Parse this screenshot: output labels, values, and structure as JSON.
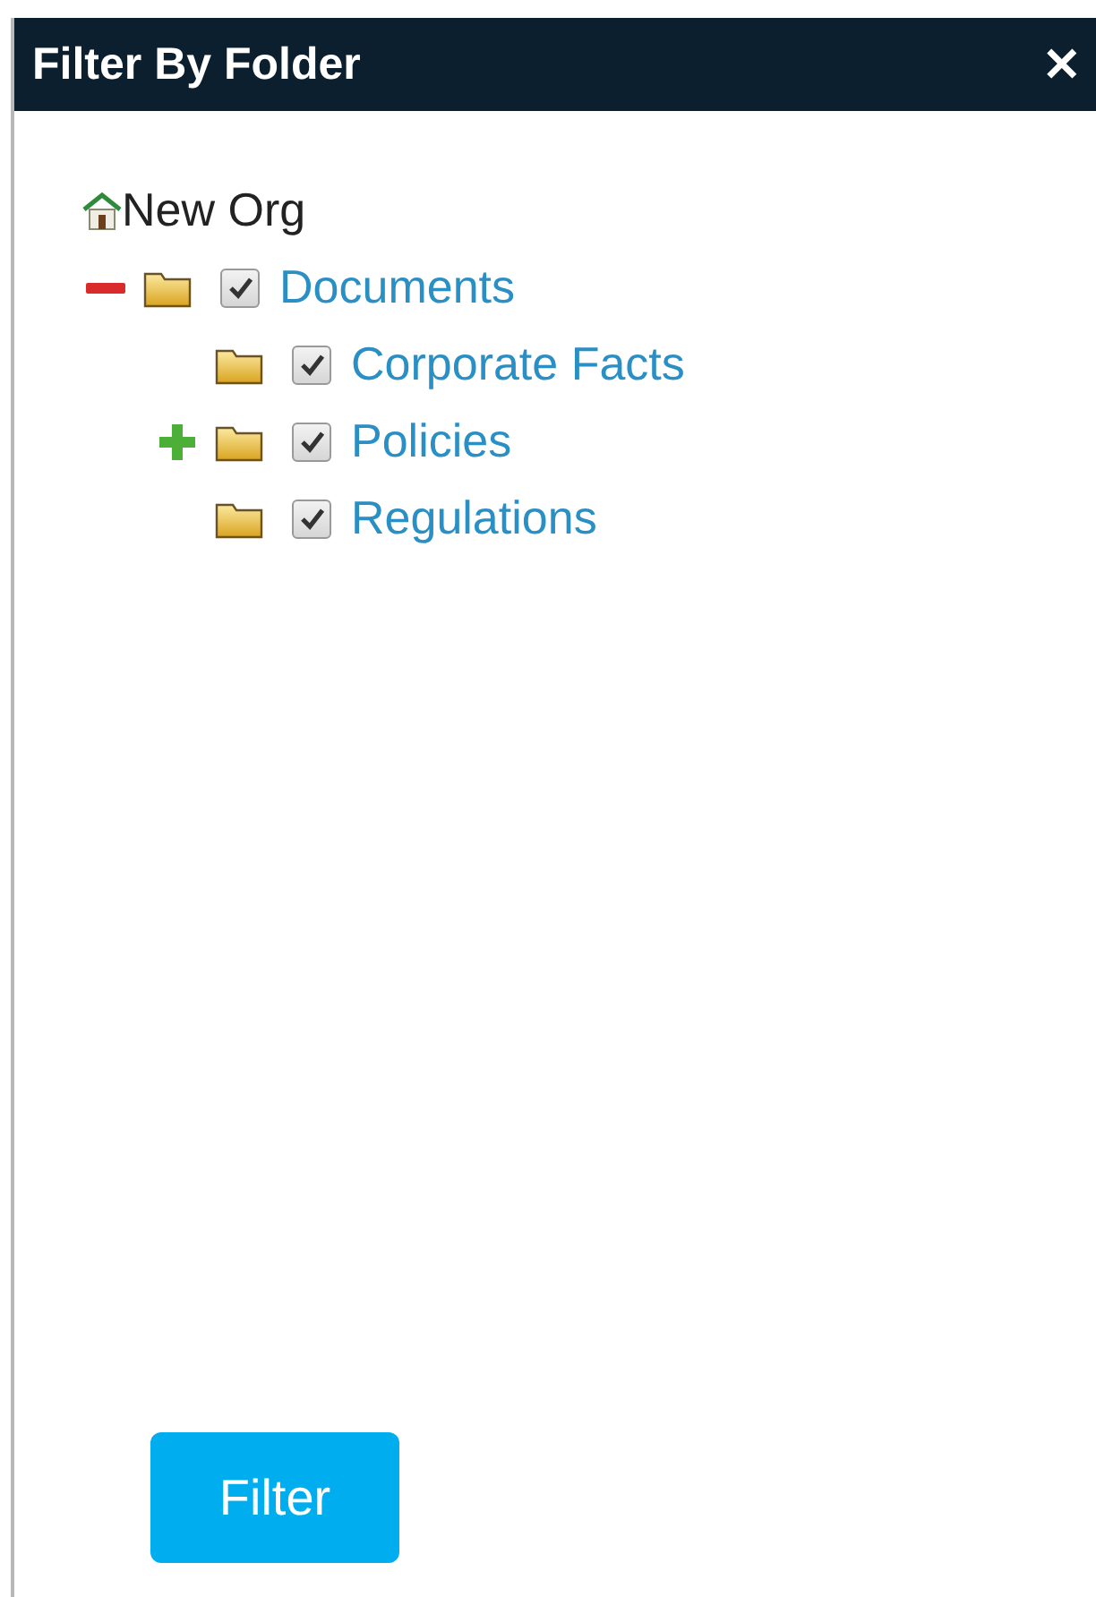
{
  "dialog": {
    "title": "Filter By Folder",
    "close": "✕"
  },
  "tree": {
    "root": {
      "label": "New Org",
      "children": [
        {
          "label": "Documents",
          "expanded": true,
          "checked": true,
          "children": [
            {
              "label": "Corporate Facts",
              "checked": true
            },
            {
              "label": "Policies",
              "expanded": false,
              "checked": true
            },
            {
              "label": "Regulations",
              "checked": true
            }
          ]
        }
      ]
    }
  },
  "button": "Filter"
}
